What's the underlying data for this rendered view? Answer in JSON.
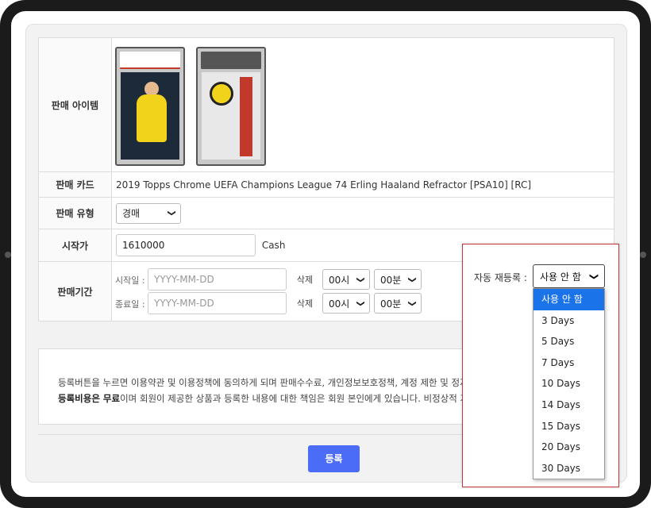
{
  "form": {
    "item_label": "판매 아이템",
    "card_label": "판매 카드",
    "card_name": "2019 Topps Chrome UEFA Champions League 74 Erling Haaland Refractor [PSA10] [RC]",
    "type_label": "판매 유형",
    "type_value": "경매",
    "price_label": "시작가",
    "price_value": "1610000",
    "price_unit": "Cash",
    "period_label": "판매기간",
    "start_label": "시작일 :",
    "end_label": "종료일 :",
    "date_placeholder": "YYYY-MM-DD",
    "delete_label": "삭제",
    "hour_value": "00시",
    "minute_value": "00분"
  },
  "notice": {
    "line1": "등록버튼을 누르면 이용약관 및 이용정책에 동의하게 되며 판매수수료, 개인정보보호정책, 계정 제한 및 정지를 확인했다는",
    "line2_bold": "등록비용은 무료",
    "line2_rest": "이며 회원이 제공한 상품과 등록한 내용에 대한 책임은 회원 본인에게 있습니다. 비정상적 거래시 계정이 제한"
  },
  "register_button": "등록",
  "auto_relist": {
    "label": "자동 재등록 :",
    "selected": "사용 안 함",
    "options": [
      "사용 안 함",
      "3 Days",
      "5 Days",
      "7 Days",
      "10 Days",
      "14 Days",
      "15 Days",
      "20 Days",
      "30 Days"
    ]
  },
  "colors": {
    "accent": "#4a6cf7",
    "selected_option": "#1a73e8",
    "popup_border": "#c43a3a"
  }
}
